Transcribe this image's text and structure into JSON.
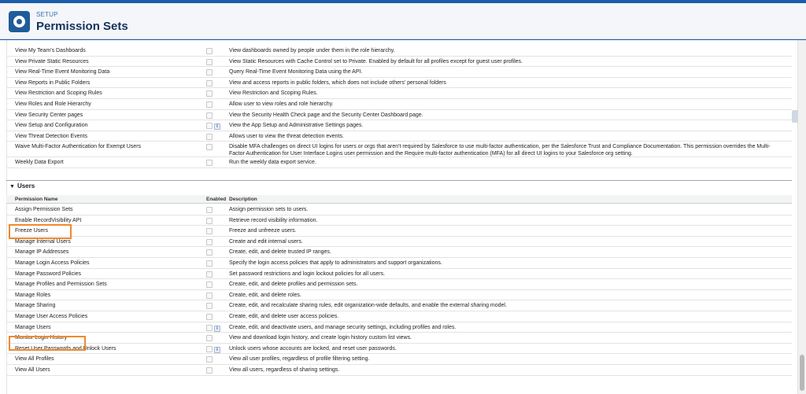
{
  "header": {
    "eyebrow": "SETUP",
    "title": "Permission Sets"
  },
  "top_rows": [
    {
      "name": "View My Team's Dashboards",
      "desc": "View dashboards owned by people under them in the role hierarchy.",
      "info": false
    },
    {
      "name": "View Private Static Resources",
      "desc": "View Static Resources with Cache Control set to Private. Enabled by default for all profiles except for guest user profiles.",
      "info": false
    },
    {
      "name": "View Real-Time Event Monitoring Data",
      "desc": "Query Real-Time Event Monitoring Data using the API.",
      "info": false
    },
    {
      "name": "View Reports in Public Folders",
      "desc": "View and access reports in public folders, which does not include others' personal folders",
      "info": false
    },
    {
      "name": "View Restriction and Scoping Rules",
      "desc": "View Restriction and Scoping Rules.",
      "info": false
    },
    {
      "name": "View Roles and Role Hierarchy",
      "desc": "Allow user to view roles and role hierarchy.",
      "info": false
    },
    {
      "name": "View Security Center pages",
      "desc": "View the Security Health Check page and the Security Center Dashboard page.",
      "info": false
    },
    {
      "name": "View Setup and Configuration",
      "desc": "View the App Setup and Administrative Settings pages.",
      "info": true
    },
    {
      "name": "View Threat Detection Events",
      "desc": "Allows user to view the threat detection events.",
      "info": false
    },
    {
      "name": "Waive Multi-Factor Authentication for Exempt Users",
      "desc": "Disable MFA challenges on direct UI logins for users or orgs that aren't required by Salesforce to use multi-factor authentication, per the Salesforce Trust and Compliance Documentation. This permission overrides the Multi-",
      "desc2": "Factor Authentication for User Interface Logins user permission and the Require multi-factor authentication (MFA) for all direct UI logins to your Salesforce org setting.",
      "info": false
    },
    {
      "name": "Weekly Data Export",
      "desc": "Run the weekly data export service.",
      "info": false
    }
  ],
  "users_section": {
    "title": "Users",
    "columns": {
      "name": "Permission Name",
      "enabled": "Enabled",
      "description": "Description"
    },
    "rows": [
      {
        "name": "Assign Permission Sets",
        "desc": "Assign permission sets to users.",
        "info": false
      },
      {
        "name": "Enable RecordVisibility API",
        "desc": "Retrieve record visibility information.",
        "info": false
      },
      {
        "name": "Freeze Users",
        "desc": "Freeze and unfreeze users.",
        "info": false
      },
      {
        "name": "Manage Internal Users",
        "desc": "Create and edit internal users.",
        "info": false
      },
      {
        "name": "Manage IP Addresses",
        "desc": "Create, edit, and delete trusted IP ranges.",
        "info": false
      },
      {
        "name": "Manage Login Access Policies",
        "desc": "Specify the login access policies that apply to administrators and support organizations.",
        "info": false
      },
      {
        "name": "Manage Password Policies",
        "desc": "Set password restrictions and login lockout policies for all users.",
        "info": false
      },
      {
        "name": "Manage Profiles and Permission Sets",
        "desc": "Create, edit, and delete profiles and permission sets.",
        "info": false
      },
      {
        "name": "Manage Roles",
        "desc": "Create, edit, and delete roles.",
        "info": false
      },
      {
        "name": "Manage Sharing",
        "desc": "Create, edit, and recalculate sharing rules, edit organization-wide defaults, and enable the external sharing model.",
        "info": false
      },
      {
        "name": "Manage User Access Policies",
        "desc": "Create, edit, and delete user access policies.",
        "info": false
      },
      {
        "name": "Manage Users",
        "desc": "Create, edit, and deactivate users, and manage security settings, including profiles and roles.",
        "info": true
      },
      {
        "name": "Monitor Login History",
        "desc": "View and download login history, and create login history custom list views.",
        "info": false
      },
      {
        "name": "Reset User Passwords and Unlock Users",
        "desc": "Unlock users whose accounts are locked, and reset user passwords.",
        "info": true
      },
      {
        "name": "View All Profiles",
        "desc": "View all user profiles, regardless of profile filtering setting.",
        "info": false
      },
      {
        "name": "View All Users",
        "desc": "View all users, regardless of sharing settings.",
        "info": false
      }
    ]
  },
  "info_icon_glyph": "i",
  "highlight_color": "#f08a2c"
}
